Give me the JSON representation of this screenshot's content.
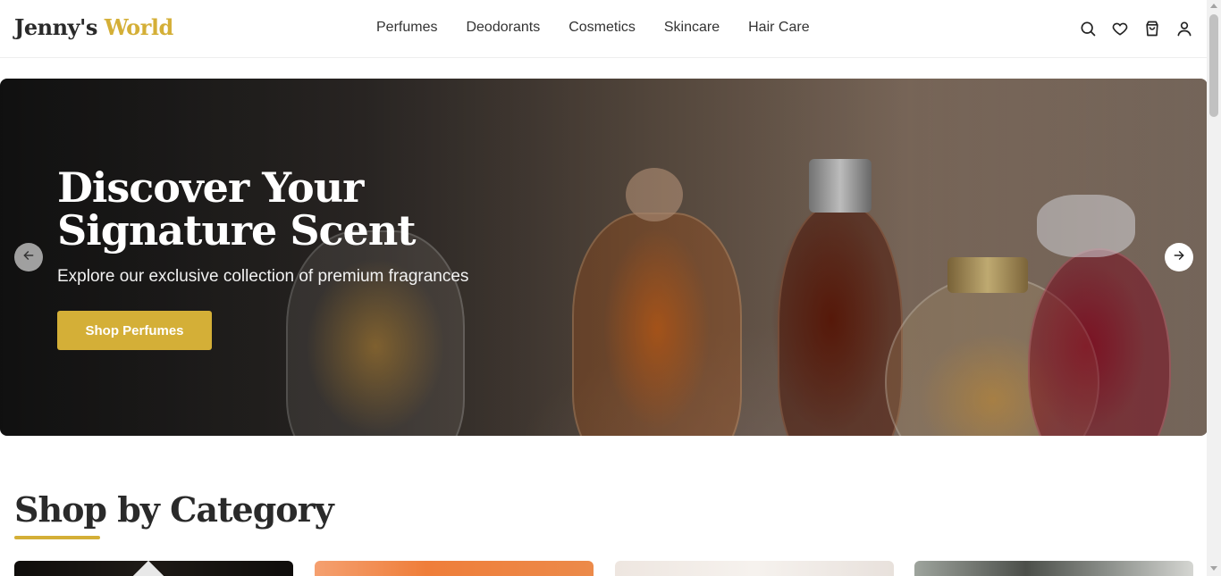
{
  "brand": {
    "name_part1": "Jenny's",
    "name_part2": "World",
    "accent_color": "#d4af37"
  },
  "nav": {
    "items": [
      {
        "label": "Perfumes"
      },
      {
        "label": "Deodorants"
      },
      {
        "label": "Cosmetics"
      },
      {
        "label": "Skincare"
      },
      {
        "label": "Hair Care"
      }
    ]
  },
  "header_icons": [
    "search-icon",
    "heart-icon",
    "shopping-bag-icon",
    "user-icon"
  ],
  "hero": {
    "title_line1": "Discover Your",
    "title_line2": "Signature Scent",
    "subtitle": "Explore our exclusive collection of premium fragrances",
    "cta_label": "Shop Perfumes",
    "prev_icon": "arrow-left-icon",
    "next_icon": "arrow-right-icon"
  },
  "categories": {
    "title": "Shop by Category"
  }
}
